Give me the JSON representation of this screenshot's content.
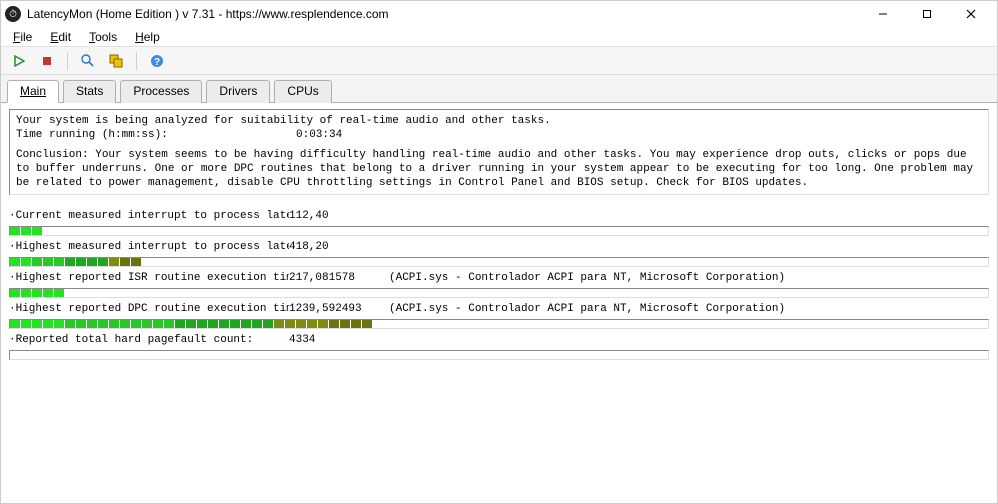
{
  "window": {
    "title": "LatencyMon  (Home Edition )  v 7.31  -  https://www.resplendence.com"
  },
  "menu": {
    "file": "File",
    "edit": "Edit",
    "tools": "Tools",
    "help": "Help"
  },
  "toolbar": {
    "start": "Start",
    "stop": "Stop",
    "report": "Report",
    "processes": "Processes",
    "help": "Help"
  },
  "tabs": {
    "main": "Main",
    "stats": "Stats",
    "processes": "Processes",
    "drivers": "Drivers",
    "cpus": "CPUs",
    "active": "main"
  },
  "analysis": {
    "line1": "Your system is being analyzed for suitability of real-time audio and other tasks.",
    "time_label": "Time running (h:mm:ss):",
    "time_value": "0:03:34",
    "conclusion": "Conclusion: Your system seems to be having difficulty handling real-time audio and other tasks. You may experience drop outs, clicks or pops due to buffer underruns. One or more DPC routines that belong to a driver running in your system appear to be executing for too long. One problem may be related to power management, disable CPU throttling settings in Control Panel and BIOS setup. Check for BIOS updates."
  },
  "metrics": [
    {
      "label": "·Current measured interrupt to process latency (µs):",
      "value": "112,40",
      "note": "",
      "segments": 3
    },
    {
      "label": "·Highest measured interrupt to process latency (µs):",
      "value": "418,20",
      "note": "",
      "segments": 12
    },
    {
      "label": "·Highest reported ISR routine execution time (µs):",
      "value": "217,081578",
      "note": "(ACPI.sys - Controlador ACPI para NT, Microsoft Corporation)",
      "segments": 5
    },
    {
      "label": "·Highest reported DPC routine execution time (µs):",
      "value": "1239,592493",
      "note": "(ACPI.sys - Controlador ACPI para NT, Microsoft Corporation)",
      "segments": 33
    },
    {
      "label": "·Reported total hard pagefault count:",
      "value": "4334",
      "note": "",
      "segments": 0
    }
  ],
  "colors": {
    "bar_green_light": "#25e225",
    "bar_green_mid": "#26c926",
    "bar_green_dark": "#1fa81f",
    "bar_olive": "#7f8c12",
    "bar_olive_dark": "#6b7310"
  }
}
